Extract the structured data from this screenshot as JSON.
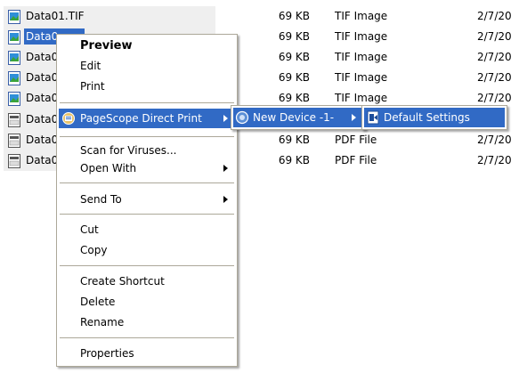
{
  "files": [
    {
      "name": "Data01.TIF",
      "size": "69 KB",
      "type": "TIF Image",
      "date": "2/7/20",
      "icon": "tif-file-icon"
    },
    {
      "name": "Data0",
      "size": "69 KB",
      "type": "TIF Image",
      "date": "2/7/20",
      "icon": "tif-file-icon"
    },
    {
      "name": "Data0",
      "size": "69 KB",
      "type": "TIF Image",
      "date": "2/7/20",
      "icon": "tif-file-icon"
    },
    {
      "name": "Data0",
      "size": "69 KB",
      "type": "TIF Image",
      "date": "2/7/20",
      "icon": "tif-file-icon"
    },
    {
      "name": "Data0",
      "size": "69 KB",
      "type": "TIF Image",
      "date": "2/7/20",
      "icon": "tif-file-icon"
    },
    {
      "name": "Data0",
      "size": "",
      "type": "",
      "date": "",
      "icon": "pdf-file-icon"
    },
    {
      "name": "Data0",
      "size": "69 KB",
      "type": "PDF File",
      "date": "2/7/20",
      "icon": "pdf-file-icon"
    },
    {
      "name": "Data0",
      "size": "69 KB",
      "type": "PDF File",
      "date": "2/7/20",
      "icon": "pdf-file-icon"
    }
  ],
  "context_menu": {
    "preview": "Preview",
    "edit": "Edit",
    "print": "Print",
    "pagescope": "PageScope Direct Print",
    "scan": "Scan for Viruses...",
    "open_with": "Open With",
    "send_to": "Send To",
    "cut": "Cut",
    "copy": "Copy",
    "create_shortcut": "Create Shortcut",
    "delete": "Delete",
    "rename": "Rename",
    "properties": "Properties"
  },
  "submenu1": {
    "new_device": "New Device -1-"
  },
  "submenu2": {
    "default_settings": "Default Settings"
  },
  "colors": {
    "highlight": "#316ac5",
    "menu_border": "#aca899"
  }
}
